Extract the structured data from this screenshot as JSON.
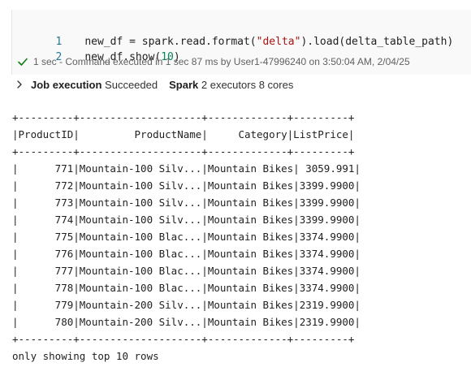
{
  "code": {
    "lines": [
      {
        "number": "1",
        "parts": [
          {
            "text": "new_df = spark.read.format(",
            "kind": "var"
          },
          {
            "text": "\"delta\"",
            "kind": "str"
          },
          {
            "text": ").load(delta_table_path)",
            "kind": "var"
          }
        ]
      },
      {
        "number": "2",
        "parts": [
          {
            "text": "new_df.show(",
            "kind": "var"
          },
          {
            "text": "10",
            "kind": "num"
          },
          {
            "text": ")",
            "kind": "var"
          }
        ]
      }
    ]
  },
  "status": {
    "duration": "1 sec",
    "message": " - Command executed in 1 sec 87 ms by User1-47996240 on 3:50:04 AM, 2/04/25",
    "icon": "check-icon",
    "icon_color": "#107c10"
  },
  "job": {
    "label": "Job execution",
    "state": "Succeeded",
    "spark_label": "Spark",
    "spark_detail": "2 executors 8 cores"
  },
  "output": {
    "separator": "+---------+--------------------+-------------+---------+",
    "header": "|ProductID|         ProductName|     Category|ListPrice|",
    "rows": [
      "|      771|Mountain-100 Silv...|Mountain Bikes| 3059.991|",
      "|      772|Mountain-100 Silv...|Mountain Bikes|3399.9900|",
      "|      773|Mountain-100 Silv...|Mountain Bikes|3399.9900|",
      "|      774|Mountain-100 Silv...|Mountain Bikes|3399.9900|",
      "|      775|Mountain-100 Blac...|Mountain Bikes|3374.9900|",
      "|      776|Mountain-100 Blac...|Mountain Bikes|3374.9900|",
      "|      777|Mountain-100 Blac...|Mountain Bikes|3374.9900|",
      "|      778|Mountain-100 Blac...|Mountain Bikes|3374.9900|",
      "|      779|Mountain-200 Silv...|Mountain Bikes|2319.9900|",
      "|      780|Mountain-200 Silv...|Mountain Bikes|2319.9900|"
    ],
    "footer": "only showing top 10 rows"
  }
}
